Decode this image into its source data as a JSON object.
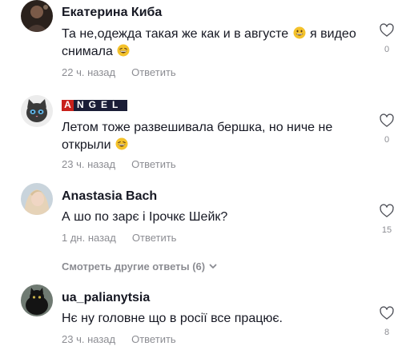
{
  "comments": [
    {
      "username": "Екатерина Киба",
      "text_part1": "Та не,одежда такая же как и в августе ",
      "text_part2": " я видео снимала ",
      "time": "22 ч. назад",
      "reply": "Ответить",
      "likes": "0"
    },
    {
      "username": "ANGEL",
      "text_part1": "Летом тоже развешивала бершка, но ниче не открыли ",
      "time": "23 ч. назад",
      "reply": "Ответить",
      "likes": "0"
    },
    {
      "username": "Anastasia Bach",
      "text_part1": "А шо по зарє і Ірочкє Шейк?",
      "time": "1 дн. назад",
      "reply": "Ответить",
      "likes": "15"
    },
    {
      "username": "ua_palianytsia",
      "text_part1": "Нє ну головне що в росії все працює.",
      "time": "23 ч. назад",
      "reply": "Ответить",
      "likes": "8"
    }
  ],
  "more_replies": "Смотреть другие ответы (6)",
  "icons": {
    "like": "heart-outline-icon",
    "more": "chevron-down-icon",
    "emoji_grin": "grinning-face-emoji",
    "emoji_laugh": "laughing-face-emoji"
  },
  "colors": {
    "text": "#161823",
    "muted": "rgba(22,24,35,0.5)",
    "background": "#ffffff"
  }
}
